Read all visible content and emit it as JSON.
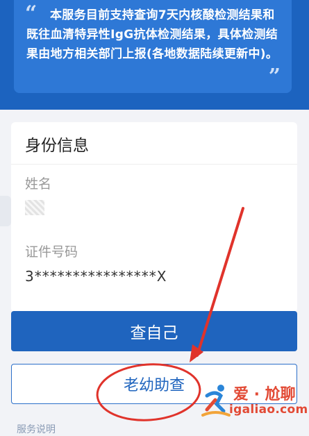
{
  "notice": {
    "open_quote": "“",
    "close_quote": "”",
    "text": "本服务目前支持查询7天内核酸检测结果和既往血清特异性IgG抗体检测结果，具体检测结果由地方相关部门上报(各地数据陆续更新中)。"
  },
  "identity": {
    "title": "身份信息",
    "name_label": "姓名",
    "name_value": "",
    "id_label": "证件号码",
    "id_value": "3****************X"
  },
  "buttons": {
    "self_label": "查自己",
    "elder_label": "老幼助查"
  },
  "bottom": {
    "link": "服务说明"
  },
  "watermark": {
    "title": "爱 · 尬聊",
    "url": "igaliao.com",
    "icon": "running-figure-logo"
  },
  "colors": {
    "brand_blue": "#1f64be",
    "annotation_red": "#e0332b"
  }
}
